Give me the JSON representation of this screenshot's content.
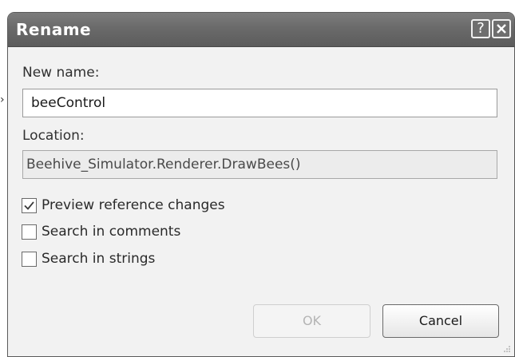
{
  "dialog": {
    "title": "Rename",
    "help_button": "?",
    "close_button_icon": "close-icon"
  },
  "new_name": {
    "label": "New name:",
    "value": "beeControl"
  },
  "location": {
    "label": "Location:",
    "value": "Beehive_Simulator.Renderer.DrawBees()"
  },
  "options": [
    {
      "label": "Preview reference changes",
      "checked": true
    },
    {
      "label": "Search in comments",
      "checked": false
    },
    {
      "label": "Search in strings",
      "checked": false
    }
  ],
  "buttons": {
    "ok": "OK",
    "ok_enabled": false,
    "cancel": "Cancel"
  },
  "colors": {
    "titlebar": "#6a6a6a",
    "client_background": "#f2f2f2"
  }
}
